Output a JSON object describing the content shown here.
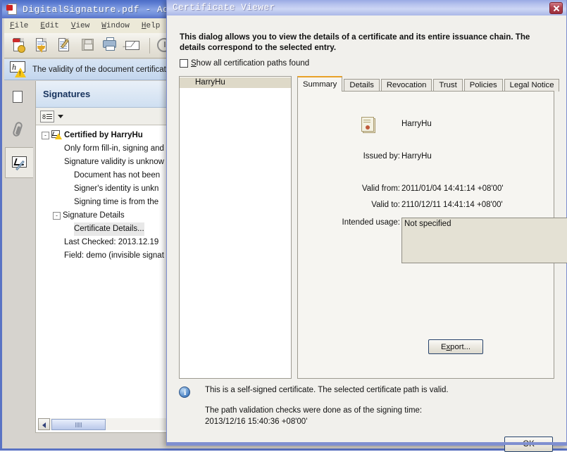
{
  "acrobat": {
    "title": "DigitalSignature.pdf - Ado",
    "window_icon": "acrobat-icon",
    "menus": [
      {
        "label": "File",
        "accel": "F"
      },
      {
        "label": "Edit",
        "accel": "E"
      },
      {
        "label": "View",
        "accel": "V"
      },
      {
        "label": "Window",
        "accel": "W"
      },
      {
        "label": "Help",
        "accel": "H"
      }
    ],
    "toolbar": [
      {
        "name": "create-pdf-icon",
        "glyph": "create-pdf"
      },
      {
        "name": "export-pdf-icon",
        "glyph": "export-pdf"
      },
      {
        "name": "edit-pdf-icon",
        "glyph": "edit-pdf"
      },
      {
        "name": "save-icon",
        "glyph": "save",
        "disabled": true
      },
      {
        "name": "print-icon",
        "glyph": "print"
      },
      {
        "name": "email-icon",
        "glyph": "email"
      },
      {
        "name": "history-icon",
        "glyph": "circle"
      }
    ],
    "notification": {
      "icon": "certification-warning-icon",
      "text": "The validity of the document certificati"
    },
    "rail": [
      {
        "name": "sidebar-item-pages",
        "glyph": "pages",
        "selected": false
      },
      {
        "name": "sidebar-item-attachments",
        "glyph": "paperclip",
        "selected": false
      },
      {
        "name": "sidebar-item-signatures",
        "glyph": "signature",
        "selected": true
      }
    ],
    "signatures_panel": {
      "title": "Signatures",
      "options_button": "signature-options-button",
      "tree": [
        {
          "label": "Certified by HarryHu",
          "indent": 0,
          "twisty": "-",
          "icon": "certification-warning-icon",
          "bold": true
        },
        {
          "label": "Only form fill-in, signing and",
          "indent": 1,
          "twisty": "",
          "icon": "",
          "bold": false
        },
        {
          "label": "Signature validity is unknow",
          "indent": 1,
          "twisty": "",
          "icon": "",
          "bold": false
        },
        {
          "label": "Document has not been",
          "indent": 2,
          "twisty": "",
          "icon": "",
          "bold": false
        },
        {
          "label": "Signer's identity is unkn",
          "indent": 2,
          "twisty": "",
          "icon": "",
          "bold": false
        },
        {
          "label": "Signing time is from the",
          "indent": 2,
          "twisty": "",
          "icon": "",
          "bold": false
        },
        {
          "label": "Signature Details",
          "indent": 1,
          "twisty": "-",
          "icon": "",
          "bold": false
        },
        {
          "label": "Certificate Details...",
          "indent": 2,
          "twisty": "",
          "icon": "",
          "bold": false,
          "selected": true
        },
        {
          "label": "Last Checked: 2013.12.19",
          "indent": 1,
          "twisty": "",
          "icon": "",
          "bold": false
        },
        {
          "label": "Field: demo (invisible signat",
          "indent": 1,
          "twisty": "",
          "icon": "",
          "bold": false
        }
      ],
      "hscrollbar": {
        "left_arrow": "scroll-left-arrow",
        "thumb": "scroll-thumb"
      }
    }
  },
  "dialog": {
    "title": "Certificate Viewer",
    "close_button": "close-icon",
    "intro": "This dialog allows you to view the details of a certificate and its entire issuance chain. The details correspond to the selected entry.",
    "checkbox": {
      "label_before": "S",
      "label_after": "how all certification paths found",
      "checked": false
    },
    "chain": [
      {
        "label": "HarryHu",
        "selected": true
      }
    ],
    "tabs": [
      {
        "label": "Summary",
        "active": true
      },
      {
        "label": "Details",
        "active": false
      },
      {
        "label": "Revocation",
        "active": false
      },
      {
        "label": "Trust",
        "active": false
      },
      {
        "label": "Policies",
        "active": false
      },
      {
        "label": "Legal Notice",
        "active": false
      }
    ],
    "summary": {
      "cert_icon": "certificate-icon",
      "subject_name": "HarryHu",
      "issued_by_label": "Issued by:",
      "issued_by_value": "HarryHu",
      "valid_from_label": "Valid from:",
      "valid_from_value": "2011/01/04 14:41:14 +08'00'",
      "valid_to_label": "Valid to:",
      "valid_to_value": "2110/12/11 14:41:14 +08'00'",
      "intended_usage_label": "Intended usage:",
      "intended_usage_value": "Not specified"
    },
    "export_button": {
      "before": "E",
      "accel": "x",
      "after": "port..."
    },
    "status": {
      "icon": "info-icon",
      "line1": "This is a self-signed certificate. The selected certificate path is valid.",
      "line2": "The path validation checks were done as of the signing time:",
      "line3": "2013/12/16 15:40:36 +08'00'"
    },
    "ok_button": "OK"
  },
  "colors": {
    "dialog_titlebar": "#b8c4ee",
    "acrobat_titlebar": "#5d7dd2",
    "active_tab_accent": "#e8a128",
    "selection": "#ded9c8",
    "dialog_border": "#7f8fd0"
  }
}
